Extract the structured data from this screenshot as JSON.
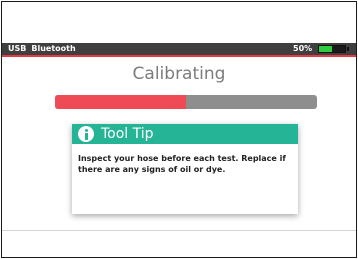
{
  "status_bar": {
    "connections": [
      "USB",
      "Bluetooth"
    ],
    "battery_percent_label": "50%",
    "battery_level": 0.5
  },
  "screen": {
    "title": "Calibrating",
    "progress": 0.5
  },
  "tooltip": {
    "icon": "info-icon",
    "title": "Tool Tip",
    "body": "Inspect your hose before each test.  Replace if there are any signs of oil or dye."
  },
  "colors": {
    "status_bar_bg": "#3f3f3f",
    "accent_red": "#e53a45",
    "progress_fill": "#ef4b56",
    "progress_track": "#8e8e8e",
    "tooltip_header": "#26b496",
    "battery_fill": "#2ecc40"
  }
}
